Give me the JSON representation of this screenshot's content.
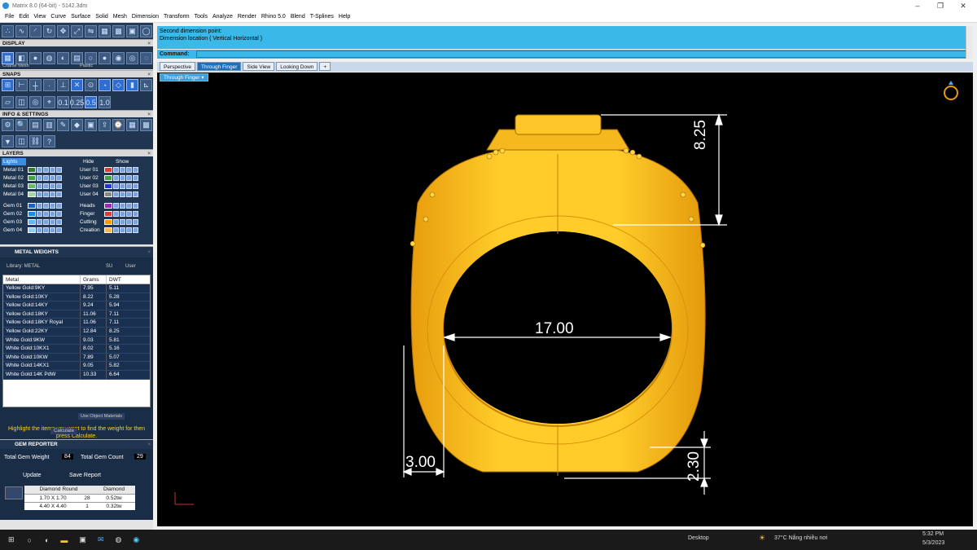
{
  "window": {
    "title": "Matrix 8.0 (64-bit) - 5142.3dm",
    "minimize": "–",
    "restore": "❐",
    "close": "✕"
  },
  "menu": [
    "File",
    "Edit",
    "View",
    "Curve",
    "Surface",
    "Solid",
    "Mesh",
    "Dimension",
    "Transform",
    "Tools",
    "Analyze",
    "Render",
    "Rhino 5.0",
    "Blend",
    "T-Splines",
    "Help"
  ],
  "panels": {
    "display": "DISPLAY",
    "display_mesh": "Coarse Mesh",
    "display_mat": "Plastic",
    "snaps": "SNAPS",
    "snap_vals": [
      "0.1",
      "0.25",
      "0.5",
      "1.0"
    ],
    "info": "INFO & SETTINGS",
    "layers": "LAYERS",
    "lights": "Lights",
    "hide": "Hide",
    "show": "Show",
    "metal_weights": "METAL WEIGHTS",
    "library": "Library: METAL",
    "su": "SU",
    "user": "User",
    "use_obj": "Use Object Materials",
    "hint": "Highlight the items you want to find the weight for then press Calculate.",
    "calculate": "Calculate",
    "gem_reporter": "GEM REPORTER",
    "total_gem_weight": "Total Gem Weight",
    "total_gem_weight_val": "84",
    "total_gem_count": "Total Gem Count",
    "total_gem_count_val": "29",
    "update": "Update",
    "save_report": "Save Report"
  },
  "layers_left": [
    {
      "name": "Metal 01",
      "color": "#2e7d32"
    },
    {
      "name": "Metal 02",
      "color": "#43a047"
    },
    {
      "name": "Metal 03",
      "color": "#66bb6a"
    },
    {
      "name": "Metal 04",
      "color": "#a5d6a7"
    },
    {
      "name": "Gem 01",
      "color": "#1565c0"
    },
    {
      "name": "Gem 02",
      "color": "#1e88e5"
    },
    {
      "name": "Gem 03",
      "color": "#64b5f6"
    },
    {
      "name": "Gem 04",
      "color": "#90caf9"
    }
  ],
  "layers_right": [
    {
      "name": "User 01",
      "color": "#e53935"
    },
    {
      "name": "User 02",
      "color": "#43a047"
    },
    {
      "name": "User 03",
      "color": "#1e3acc"
    },
    {
      "name": "User 04",
      "color": "#888888"
    },
    {
      "name": "Heads",
      "color": "#9c27b0"
    },
    {
      "name": "Finger",
      "color": "#e53935"
    },
    {
      "name": "Cutting",
      "color": "#ff9800"
    },
    {
      "name": "Creation",
      "color": "#ffb74d"
    }
  ],
  "metal_table": {
    "headers": [
      "Metal",
      "Grams",
      "DWT"
    ],
    "rows": [
      [
        "Yellow Gold:9KY",
        "7.95",
        "5.11"
      ],
      [
        "Yellow Gold:10KY",
        "8.22",
        "5.28"
      ],
      [
        "Yellow Gold:14KY",
        "9.24",
        "5.94"
      ],
      [
        "Yellow Gold:18KY",
        "11.06",
        "7.11"
      ],
      [
        "Yellow Gold:18KY Royal",
        "11.06",
        "7.11"
      ],
      [
        "Yellow Gold:22KY",
        "12.84",
        "8.25"
      ],
      [
        "White Gold:9KW",
        "9.03",
        "5.81"
      ],
      [
        "White Gold:10KX1",
        "8.02",
        "5.16"
      ],
      [
        "White Gold:10KW",
        "7.89",
        "5.07"
      ],
      [
        "White Gold:14KX1",
        "9.05",
        "5.82"
      ],
      [
        "White Gold:14K PdW",
        "10.33",
        "6.64"
      ]
    ]
  },
  "gem_table": {
    "headers": [
      "Diamond Round",
      "Diamond"
    ],
    "rows": [
      [
        "1.70 X 1.70",
        "28",
        "0.52tw"
      ],
      [
        "4.40 X 4.40",
        "1",
        "0.32tw"
      ]
    ]
  },
  "command": {
    "line1": "Second dimension point:",
    "line2": "Dimension location ( Vertical  Horizontal )",
    "label": "Command:"
  },
  "tabs": [
    "Perspective",
    "Through Finger",
    "Side View",
    "Looking Down",
    "+"
  ],
  "viewport_title": "Through Finger",
  "dimensions": {
    "top": "8.25",
    "inner": "17.00",
    "band": "3.00",
    "bottom": "2.30"
  },
  "taskbar": {
    "desktop": "Desktop",
    "weather": "37°C  Nắng nhiều nơi",
    "time": "5:32 PM",
    "date": "5/3/2023"
  }
}
